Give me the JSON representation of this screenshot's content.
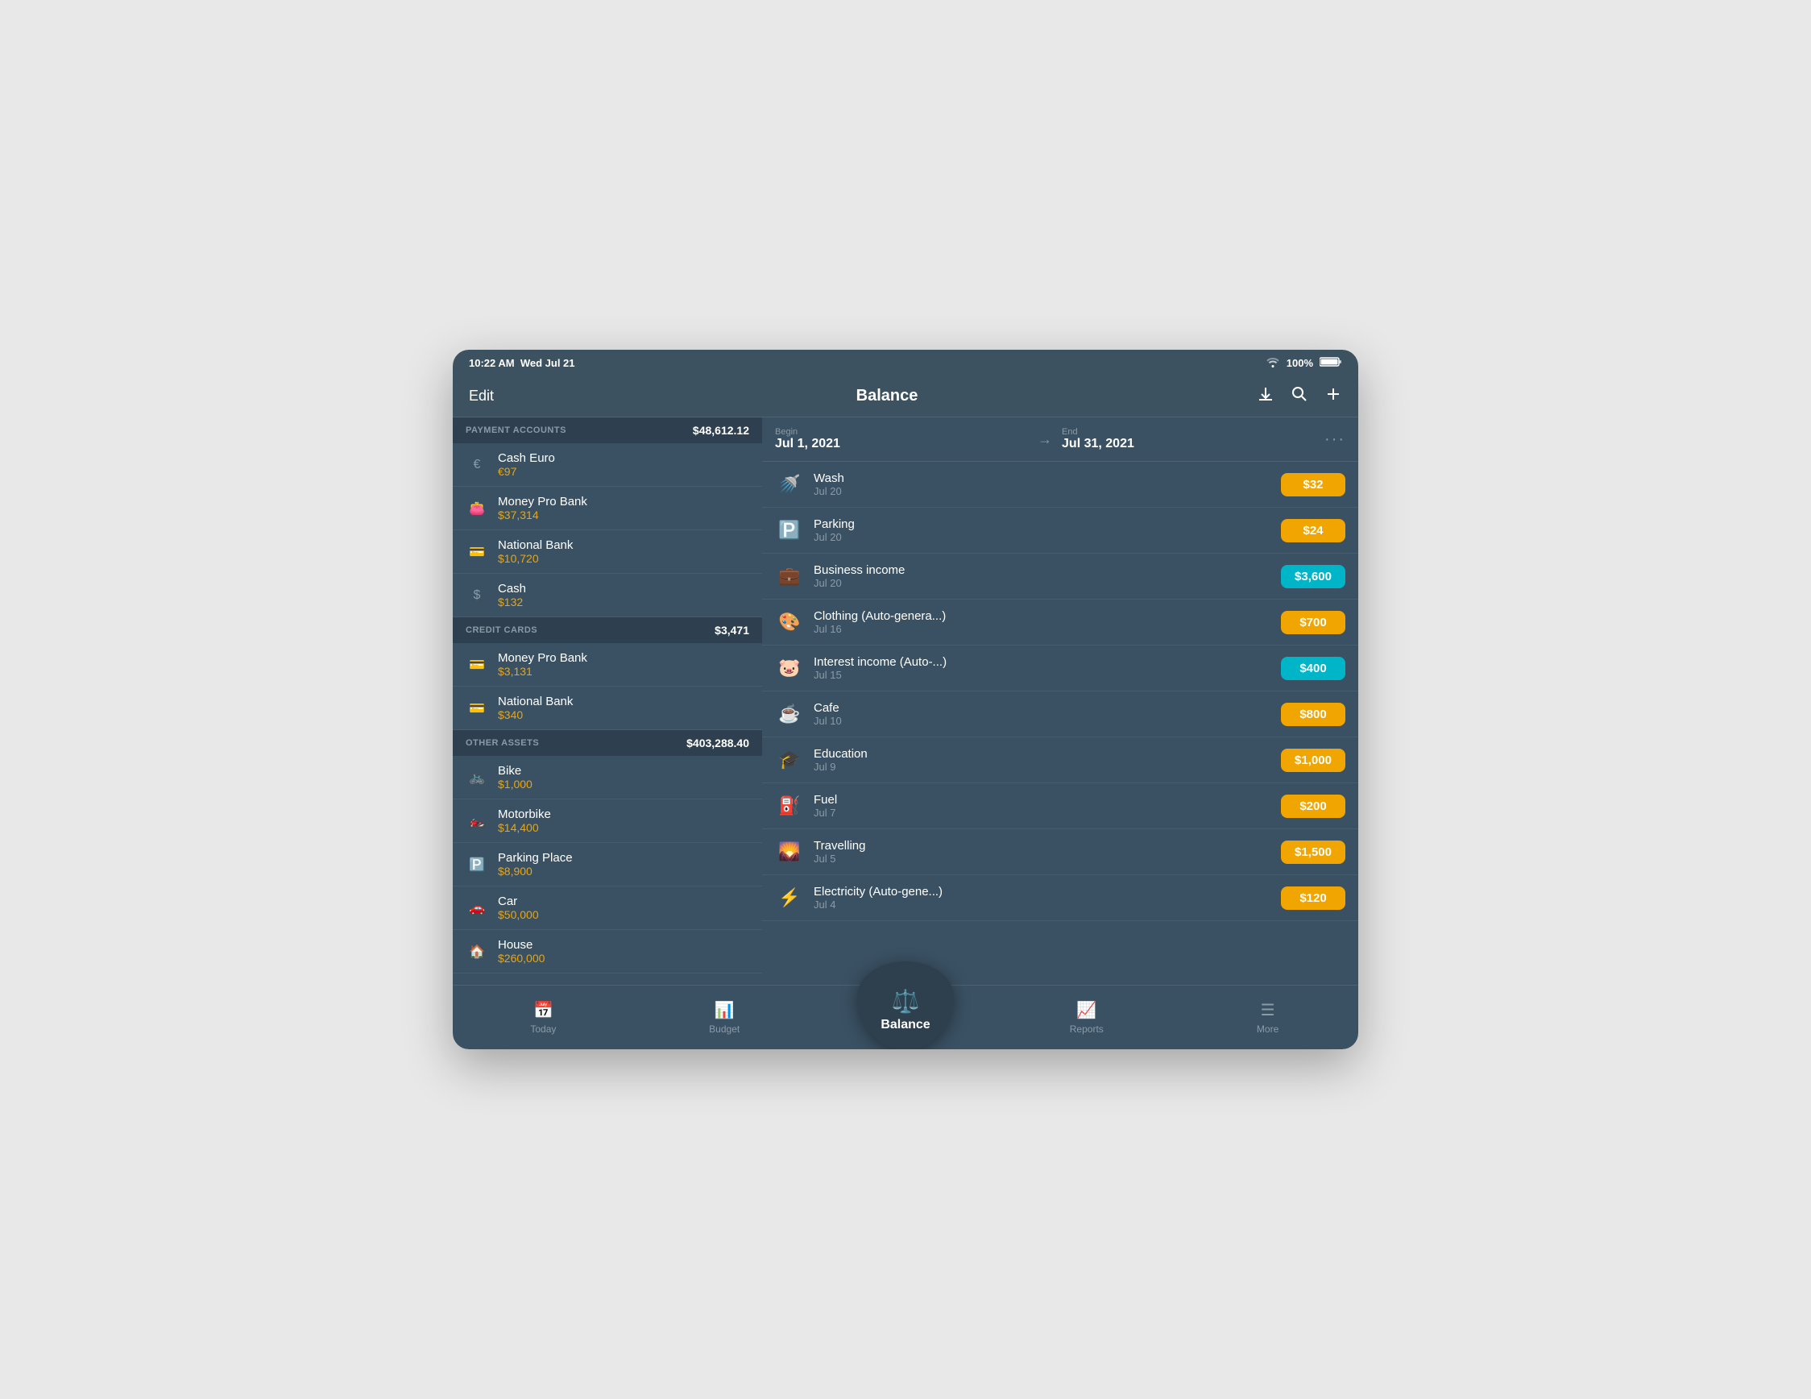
{
  "statusBar": {
    "time": "10:22 AM",
    "date": "Wed Jul 21",
    "wifi": "wifi",
    "battery": "100%"
  },
  "header": {
    "edit": "Edit",
    "title": "Balance",
    "downloadIcon": "↓",
    "searchIcon": "🔍",
    "addIcon": "+"
  },
  "leftPanel": {
    "sections": [
      {
        "id": "payment",
        "title": "PAYMENT ACCOUNTS",
        "total": "$48,612.12",
        "accounts": [
          {
            "id": "cash-euro",
            "icon": "€",
            "name": "Cash Euro",
            "balance": "€97"
          },
          {
            "id": "money-pro-bank-pay",
            "icon": "👛",
            "name": "Money Pro Bank",
            "balance": "$37,314"
          },
          {
            "id": "national-bank-pay",
            "icon": "💳",
            "name": "National Bank",
            "balance": "$10,720"
          },
          {
            "id": "cash",
            "icon": "$",
            "name": "Cash",
            "balance": "$132"
          }
        ]
      },
      {
        "id": "credit",
        "title": "CREDIT CARDS",
        "total": "$3,471",
        "accounts": [
          {
            "id": "money-pro-bank-cc",
            "icon": "💳",
            "name": "Money Pro Bank",
            "balance": "$3,131"
          },
          {
            "id": "national-bank-cc",
            "icon": "💳",
            "name": "National Bank",
            "balance": "$340"
          }
        ]
      },
      {
        "id": "assets",
        "title": "OTHER ASSETS",
        "total": "$403,288.40",
        "accounts": [
          {
            "id": "bike",
            "icon": "🚲",
            "name": "Bike",
            "balance": "$1,000"
          },
          {
            "id": "motorbike",
            "icon": "🏍️",
            "name": "Motorbike",
            "balance": "$14,400"
          },
          {
            "id": "parking",
            "icon": "🅿️",
            "name": "Parking Place",
            "balance": "$8,900"
          },
          {
            "id": "car",
            "icon": "🚗",
            "name": "Car",
            "balance": "$50,000"
          },
          {
            "id": "house",
            "icon": "🏠",
            "name": "House",
            "balance": "$260,000"
          }
        ]
      }
    ]
  },
  "rightPanel": {
    "dateRange": {
      "beginLabel": "Begin",
      "beginDate": "Jul 1, 2021",
      "endLabel": "End",
      "endDate": "Jul 31, 2021"
    },
    "transactions": [
      {
        "id": "wash",
        "icon": "🚿",
        "name": "Wash",
        "date": "Jul 20",
        "amount": "$32",
        "type": "expense"
      },
      {
        "id": "parking-trans",
        "icon": "🅿️",
        "name": "Parking",
        "date": "Jul 20",
        "amount": "$24",
        "type": "expense"
      },
      {
        "id": "business-income",
        "icon": "💼",
        "name": "Business income",
        "date": "Jul 20",
        "amount": "$3,600",
        "type": "income"
      },
      {
        "id": "clothing",
        "icon": "🎨",
        "name": "Clothing (Auto-genera...)",
        "date": "Jul 16",
        "amount": "$700",
        "type": "expense"
      },
      {
        "id": "interest-income",
        "icon": "🐷",
        "name": "Interest income (Auto-...)",
        "date": "Jul 15",
        "amount": "$400",
        "type": "income"
      },
      {
        "id": "cafe",
        "icon": "☕",
        "name": "Cafe",
        "date": "Jul 10",
        "amount": "$800",
        "type": "expense"
      },
      {
        "id": "education",
        "icon": "🎓",
        "name": "Education",
        "date": "Jul 9",
        "amount": "$1,000",
        "type": "expense"
      },
      {
        "id": "fuel",
        "icon": "⛽",
        "name": "Fuel",
        "date": "Jul 7",
        "amount": "$200",
        "type": "expense"
      },
      {
        "id": "travelling",
        "icon": "🌄",
        "name": "Travelling",
        "date": "Jul 5",
        "amount": "$1,500",
        "type": "expense"
      },
      {
        "id": "electricity",
        "icon": "⚡",
        "name": "Electricity (Auto-gene...)",
        "date": "Jul 4",
        "amount": "$120",
        "type": "expense"
      }
    ]
  },
  "tabBar": {
    "tabs": [
      {
        "id": "today",
        "icon": "📅",
        "label": "Today"
      },
      {
        "id": "budget",
        "icon": "📊",
        "label": "Budget"
      },
      {
        "id": "balance",
        "icon": "⚖️",
        "label": "Balance"
      },
      {
        "id": "reports",
        "icon": "📈",
        "label": "Reports"
      },
      {
        "id": "more",
        "icon": "☰",
        "label": "More"
      }
    ]
  }
}
